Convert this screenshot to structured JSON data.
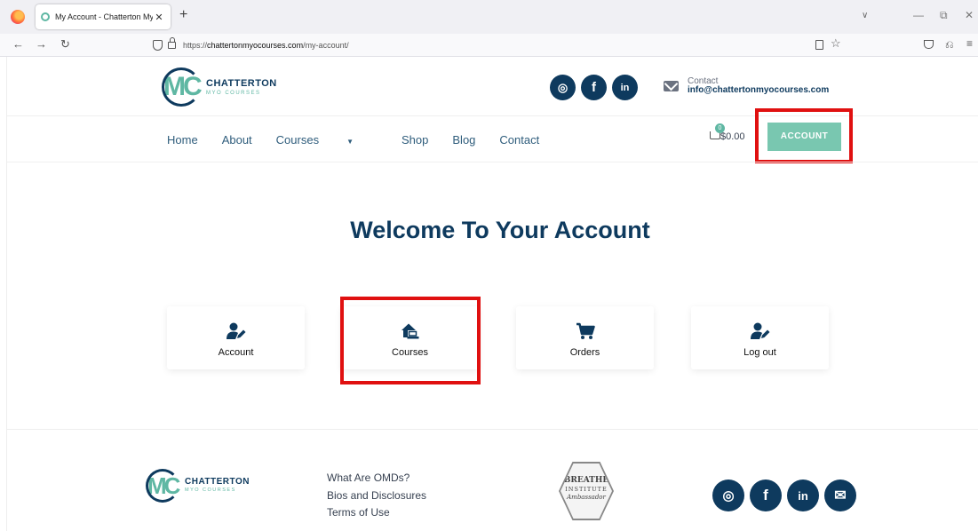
{
  "browser": {
    "tab_title": "My Account - Chatterton Myo C",
    "tab_close": "✕",
    "new_tab": "+",
    "url_prefix": "https://",
    "url_host": "chattertonmyocourses.com",
    "url_path": "/my-account/",
    "back": "←",
    "forward": "→",
    "reload": "↻",
    "star": "☆",
    "tabs_list": "∨",
    "minimize": "—",
    "restore": "⧉",
    "close": "✕",
    "ext": "⎌",
    "menu": "≡"
  },
  "site": {
    "logo": {
      "mark": "MC",
      "name": "CHATTERTON",
      "sub": "MYO COURSES"
    },
    "social": [
      {
        "icon": "instagram-icon",
        "glyph": "◎"
      },
      {
        "icon": "facebook-icon",
        "glyph": "f"
      },
      {
        "icon": "linkedin-icon",
        "glyph": "in"
      }
    ],
    "contact": {
      "label": "Contact",
      "email": "info@chattertonmyocourses.com"
    },
    "menu": {
      "home": "Home",
      "about": "About",
      "courses": "Courses",
      "courses_caret": "▼",
      "shop": "Shop",
      "blog": "Blog",
      "contact": "Contact"
    },
    "cart": {
      "count": "0",
      "total": "$0.00"
    },
    "account_button": "ACCOUNT",
    "welcome": "Welcome To Your Account",
    "cards": {
      "account": "Account",
      "courses": "Courses",
      "orders": "Orders",
      "logout": "Log out"
    },
    "footer": {
      "links": [
        "What Are OMDs?",
        "Bios and Disclosures",
        "Terms of Use"
      ],
      "badge": {
        "line1": "BREATHE",
        "line2": "INSTITUTE",
        "line3": "Ambassador"
      },
      "social": [
        {
          "icon": "instagram-icon",
          "glyph": "◎"
        },
        {
          "icon": "facebook-icon",
          "glyph": "f"
        },
        {
          "icon": "linkedin-icon",
          "glyph": "in"
        },
        {
          "icon": "email-icon",
          "glyph": "✉"
        }
      ]
    }
  },
  "colors": {
    "brand_navy": "#0e3a5e",
    "brand_teal": "#5fb7a3",
    "account_button": "#79c7b0",
    "highlight_box": "#e01010"
  }
}
